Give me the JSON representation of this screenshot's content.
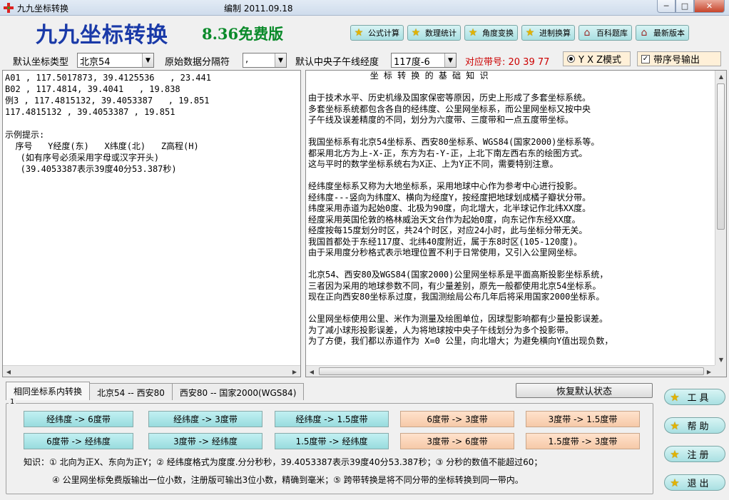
{
  "window": {
    "title": "九九坐标转换",
    "center_text": "编制    2011.09.18",
    "min_glyph": "─",
    "max_glyph": "□",
    "close_glyph": "✕"
  },
  "brand": {
    "name": "九九坐标转换",
    "version": "8.36免费版"
  },
  "top_buttons": [
    {
      "label": "公式计算",
      "icon": "star-icon"
    },
    {
      "label": "数理统计",
      "icon": "star-icon"
    },
    {
      "label": "角度变换",
      "icon": "star-icon"
    },
    {
      "label": "进制换算",
      "icon": "star-icon"
    },
    {
      "label": "百科题库",
      "icon": "house-icon"
    },
    {
      "label": "最新版本",
      "icon": "house-icon"
    }
  ],
  "options": {
    "coord_type_label": "默认坐标类型",
    "coord_type_value": "北京54",
    "separator_label": "原始数据分隔符",
    "separator_value": ",",
    "meridian_label": "默认中央子午线经度",
    "meridian_value": "117度-6",
    "zone_label": "对应带号: 20  39  77",
    "mode_label": "Y X Z模式",
    "serial_label": "带序号输出"
  },
  "input_text": "A01 , 117.5017873, 39.4125536   , 23.441\nB02 , 117.4814, 39.4041   , 19.838\n例3 , 117.4815132, 39.4053387   , 19.851\n117.4815132 , 39.4053387 , 19.851\n\n示例提示:\n  序号   Y经度(东)   X纬度(北)   Z高程(H)\n   (如有序号必须采用字母或汉字开头)\n   (39.4053387表示39度40分53.387秒)",
  "info_text": "            坐 标 转 换 的 基 础 知 识\n\n由于技术水平、历史机缘及国家保密等原因，历史上形成了多套坐标系统。\n多套坐标系统都包含各自的经纬度、公里网坐标系，而公里网坐标又按中央\n子午线及误差精度的不同，划分为六度带、三度带和一点五度带坐标。\n\n我国坐标系有北京54坐标系、西安80坐标系、WGS84(国家2000)坐标系等。\n都采用北方为上-X-正，东方为右-Y-正，上北下南左西右东的绘图方式。\n这与平时的数学坐标系统右为X正、上为Y正不同，需要特别注意。\n\n经纬度坐标系又称为大地坐标系，采用地球中心作为参考中心进行投影。\n经纬度---竖向为纬度X、横向为经度Y，按经度把地球划成橘子瓣状分带。\n纬度采用赤道为起始0度、北极为90度，向北增大，北半球记作北纬XX度。\n经度采用英国伦敦的格林威治天文台作为起始0度，向东记作东经XX度。\n经度按每15度划分时区，共24个时区，对应24小时，此与坐标分带无关。\n我国首都处于东经117度、北纬40度附近，属于东8时区(105-120度)。\n由于采用度分秒格式表示地理位置不利于日常使用，又引入公里网坐标。\n\n北京54、西安80及WGS84(国家2000)公里网坐标系是平面高斯投影坐标系统，\n三者因为采用的地球参数不同，有少量差别，原先一般都使用北京54坐标系。\n现在正向西安80坐标系过度，我国测绘局公布几年后将采用国家2000坐标系。\n\n公里网坐标使用公里、米作为测量及绘图单位，因球型影响都有少量投影误差。\n为了减小球形投影误差，人为将地球按中央子午线划分为多个投影带。\n为了方便，我们都以赤道作为 X=0 公里，向北增大；为避免横向Y值出现负数，",
  "tabs": [
    {
      "label": "相同坐标系内转换"
    },
    {
      "label": "北京54 -- 西安80"
    },
    {
      "label": "西安80 -- 国家2000(WGS84)"
    }
  ],
  "restore_label": "恢复默认状态",
  "group_label": "1",
  "convert_buttons": {
    "row1": [
      "经纬度 -> 6度带",
      "经纬度 -> 3度带",
      "经纬度 -> 1.5度带",
      "6度带 -> 3度带",
      "3度带 -> 1.5度带"
    ],
    "row2": [
      "6度带 -> 经纬度",
      "3度带 -> 经纬度",
      "1.5度带 -> 经纬度",
      "3度带 -> 6度带",
      "1.5度带 -> 3度带"
    ]
  },
  "knowledge": {
    "line1": "知识：① 北向为正X、东向为正Y；② 经纬度格式为度度.分分秒秒，39.4053387表示39度40分53.387秒；③ 分秒的数值不能超过60；",
    "line2": "④ 公里网坐标免费版输出一位小数，注册版可输出3位小数，精确到毫米；⑤ 跨带转换是将不同分带的坐标转换到同一带内。"
  },
  "side_buttons": [
    {
      "label": "工具"
    },
    {
      "label": "帮助"
    },
    {
      "label": "注册"
    },
    {
      "label": "退出"
    }
  ],
  "colors": {
    "brand": "#1a3aa8",
    "version": "#0a8a2a",
    "zone": "#cc0000",
    "cyan_button": "#a9e0e2",
    "peach_button": "#f6c9a8"
  }
}
